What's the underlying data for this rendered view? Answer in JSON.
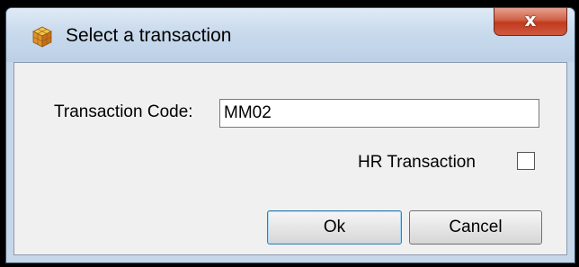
{
  "window": {
    "title": "Select a transaction",
    "title_icon": "package-cube-icon",
    "close_glyph": "x"
  },
  "form": {
    "transaction_code_label": "Transaction Code:",
    "transaction_code_value": "MM02",
    "hr_transaction_label": "HR Transaction",
    "hr_transaction_checked": false
  },
  "buttons": {
    "ok_label": "Ok",
    "cancel_label": "Cancel"
  },
  "colors": {
    "close_button": "#c13a1e",
    "title_bar": "#c9daec",
    "dialog_body": "#f0f0f0",
    "default_button_border": "#3c7fb1"
  }
}
